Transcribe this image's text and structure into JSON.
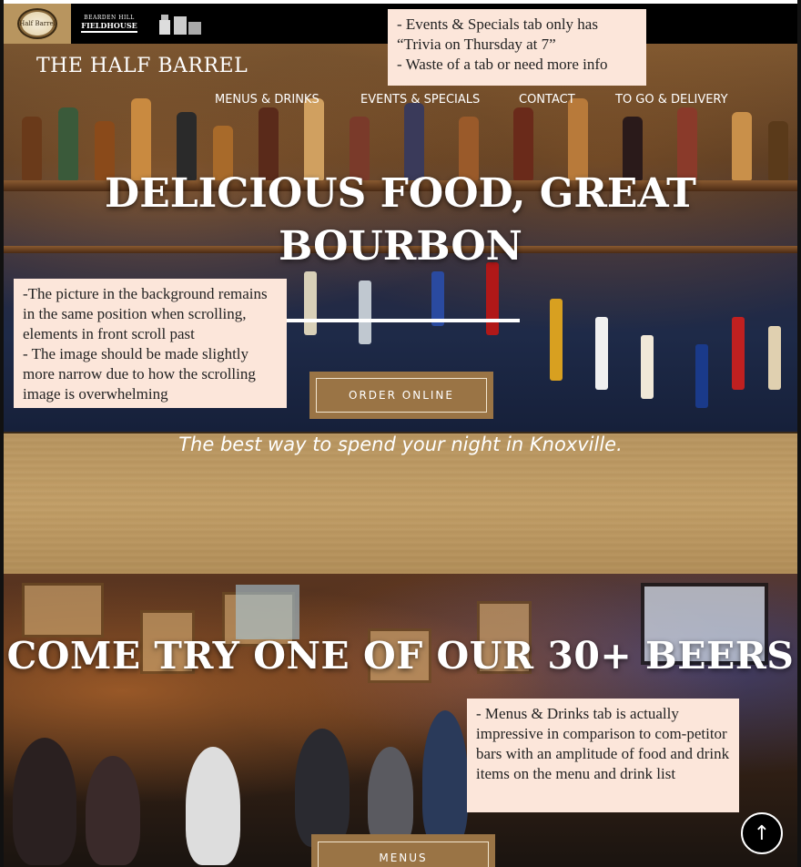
{
  "logos": {
    "half_barrel_text": "Half Barrel",
    "fieldhouse_top": "BEARDEN HILL",
    "fieldhouse_name": "FIELDHOUSE"
  },
  "header": {
    "brand": "THE HALF BARREL",
    "nav": [
      {
        "label": "MENUS & DRINKS"
      },
      {
        "label": "EVENTS & SPECIALS"
      },
      {
        "label": "CONTACT"
      },
      {
        "label": "TO GO & DELIVERY"
      }
    ]
  },
  "hero": {
    "title": "DELICIOUS FOOD, GREAT BOURBON",
    "cta_label": "ORDER ONLINE"
  },
  "tagline": "The best way to spend your night in Knoxville.",
  "beers": {
    "title": "COME TRY ONE OF OUR 30+ BEERS",
    "cta_label": "MENUS"
  },
  "scroll_top_icon": "arrow-up-icon",
  "notes": [
    {
      "text": "- Events & Specials tab only has “Trivia on Thursday at 7”\n- Waste of a tab or need more info"
    },
    {
      "text": "-The picture in the background remains in the same position when scrolling, elements in front scroll past\n- The image should be made slightly more narrow due to how the scrolling image is overwhelming"
    },
    {
      "text": "- Menus & Drinks tab is actually impressive  in comparison to com-petitor bars with an amplitude of food and drink items on the menu and drink list"
    }
  ],
  "colors": {
    "accent": "#9a7445",
    "wood": "#b8955f",
    "note_bg": "#fce6da"
  }
}
